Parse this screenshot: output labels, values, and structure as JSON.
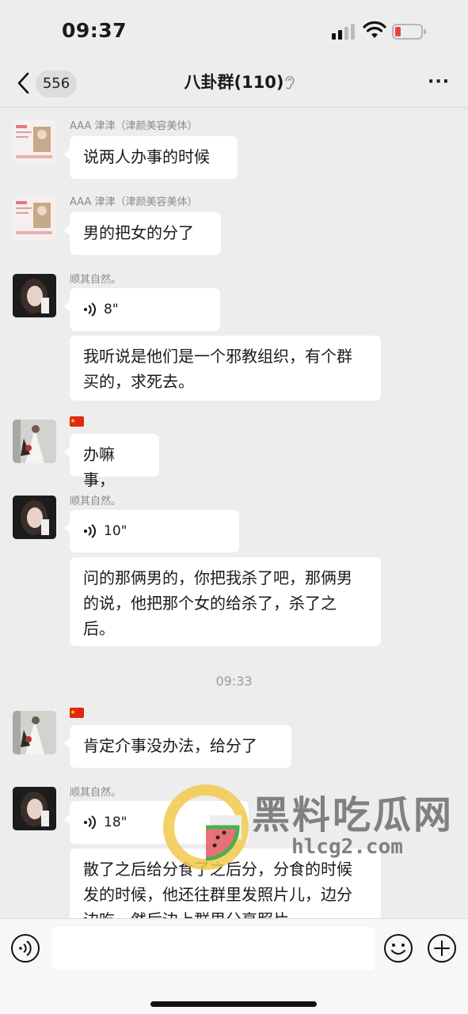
{
  "status_bar": {
    "time": "09:37"
  },
  "header": {
    "back_label": "",
    "unread_count": "556",
    "title": "八卦群(110)"
  },
  "messages": [
    {
      "sender": "AAA 津津（津颜美容美体）",
      "text": "说两人办事的时候"
    },
    {
      "sender": "AAA 津津（津颜美容美体）",
      "text": "男的把女的分了"
    },
    {
      "sender": "顺其自然。",
      "voice_duration": "8\"",
      "text": "我听说是他们是一个邪教组织，有个群买的，求死去。"
    },
    {
      "sender": "",
      "text": "办嘛事，"
    },
    {
      "sender": "顺其自然。",
      "voice_duration": "10\"",
      "text": "问的那俩男的，你把我杀了吧，那俩男的说，他把那个女的给杀了，杀了之后。"
    },
    {
      "timestamp": "09:33"
    },
    {
      "sender": "",
      "text": "肯定介事没办法，给分了"
    },
    {
      "sender": "顺其自然。",
      "voice_duration": "18\"",
      "text": "散了之后给分食了之后分，分食的时候发的时候，他还往群里发照片儿，边分边吃，然后边上群里分享照片"
    }
  ],
  "watermark": {
    "brand": "黑料吃瓜网",
    "url": "hlcg2.com"
  },
  "input_bar": {
    "placeholder": ""
  },
  "icons": {
    "signal": "signal-icon",
    "wifi": "wifi-icon",
    "battery": "battery-low-icon",
    "back": "chevron-left-icon",
    "mute": "ear-mute-icon",
    "more": "more-dots-icon",
    "voice_input": "voice-input-icon",
    "emoji": "emoji-icon",
    "plus": "plus-circle-icon"
  },
  "colors": {
    "background": "#ededed",
    "bubble": "#ffffff",
    "battery_low": "#e64340"
  }
}
